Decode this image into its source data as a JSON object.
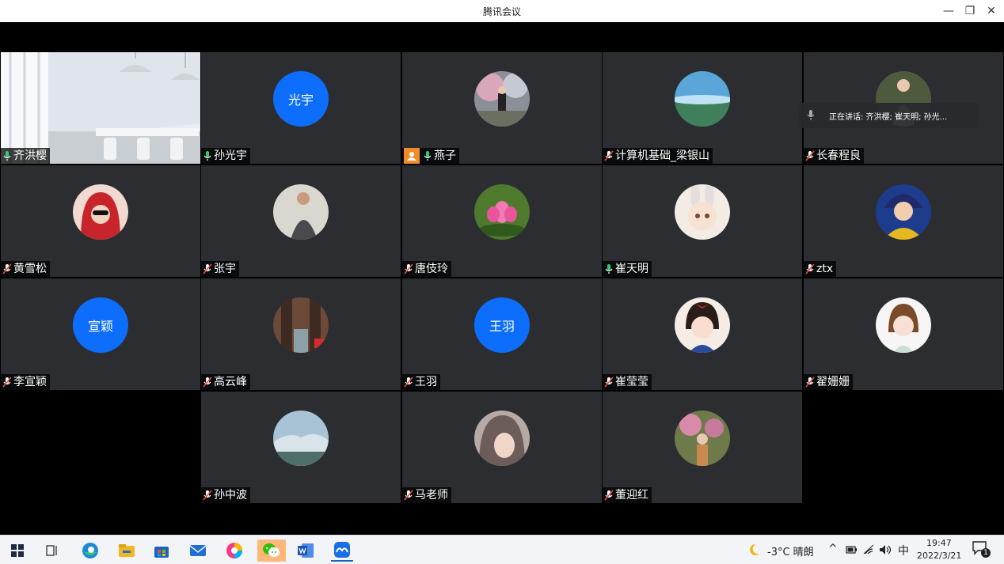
{
  "window": {
    "title": "腾讯会议"
  },
  "speaking": {
    "text": "正在讲话: 齐洪樱; 崔天明; 孙光..."
  },
  "tiles": [
    {
      "name": "齐洪樱",
      "mic": "on",
      "kind": "video"
    },
    {
      "name": "孙光宇",
      "mic": "on",
      "kind": "text",
      "avatar_text": "光宇"
    },
    {
      "name": "燕子",
      "mic": "on",
      "kind": "photo",
      "host": true
    },
    {
      "name": "计算机基础_梁银山",
      "mic": "muted",
      "kind": "photo"
    },
    {
      "name": "长春程良",
      "mic": "muted",
      "kind": "photo"
    },
    {
      "name": "黄雪松",
      "mic": "muted",
      "kind": "photo"
    },
    {
      "name": "张宇",
      "mic": "muted",
      "kind": "photo"
    },
    {
      "name": "唐伎玲",
      "mic": "muted",
      "kind": "photo"
    },
    {
      "name": "崔天明",
      "mic": "on",
      "kind": "photo"
    },
    {
      "name": "ztx",
      "mic": "muted",
      "kind": "photo"
    },
    {
      "name": "李宣颖",
      "mic": "muted",
      "kind": "text",
      "avatar_text": "宣颖"
    },
    {
      "name": "高云峰",
      "mic": "muted",
      "kind": "photo"
    },
    {
      "name": "王羽",
      "mic": "muted",
      "kind": "text",
      "avatar_text": "王羽"
    },
    {
      "name": "崔莹莹",
      "mic": "muted",
      "kind": "photo"
    },
    {
      "name": "翟姗姗",
      "mic": "muted",
      "kind": "photo"
    },
    {
      "name": "孙中波",
      "mic": "muted",
      "kind": "photo"
    },
    {
      "name": "马老师",
      "mic": "muted",
      "kind": "photo"
    },
    {
      "name": "董迎红",
      "mic": "muted",
      "kind": "photo"
    }
  ],
  "taskbar": {
    "weather": "-3°C 晴朗",
    "ime": "中",
    "time": "19:47",
    "date": "2022/3/21",
    "notification_count": "1"
  },
  "colors": {
    "accent": "#0d6efd",
    "mic_on": "#2ecc71",
    "mic_muted": "#e74c3c",
    "tile_bg": "#2b2d31"
  }
}
